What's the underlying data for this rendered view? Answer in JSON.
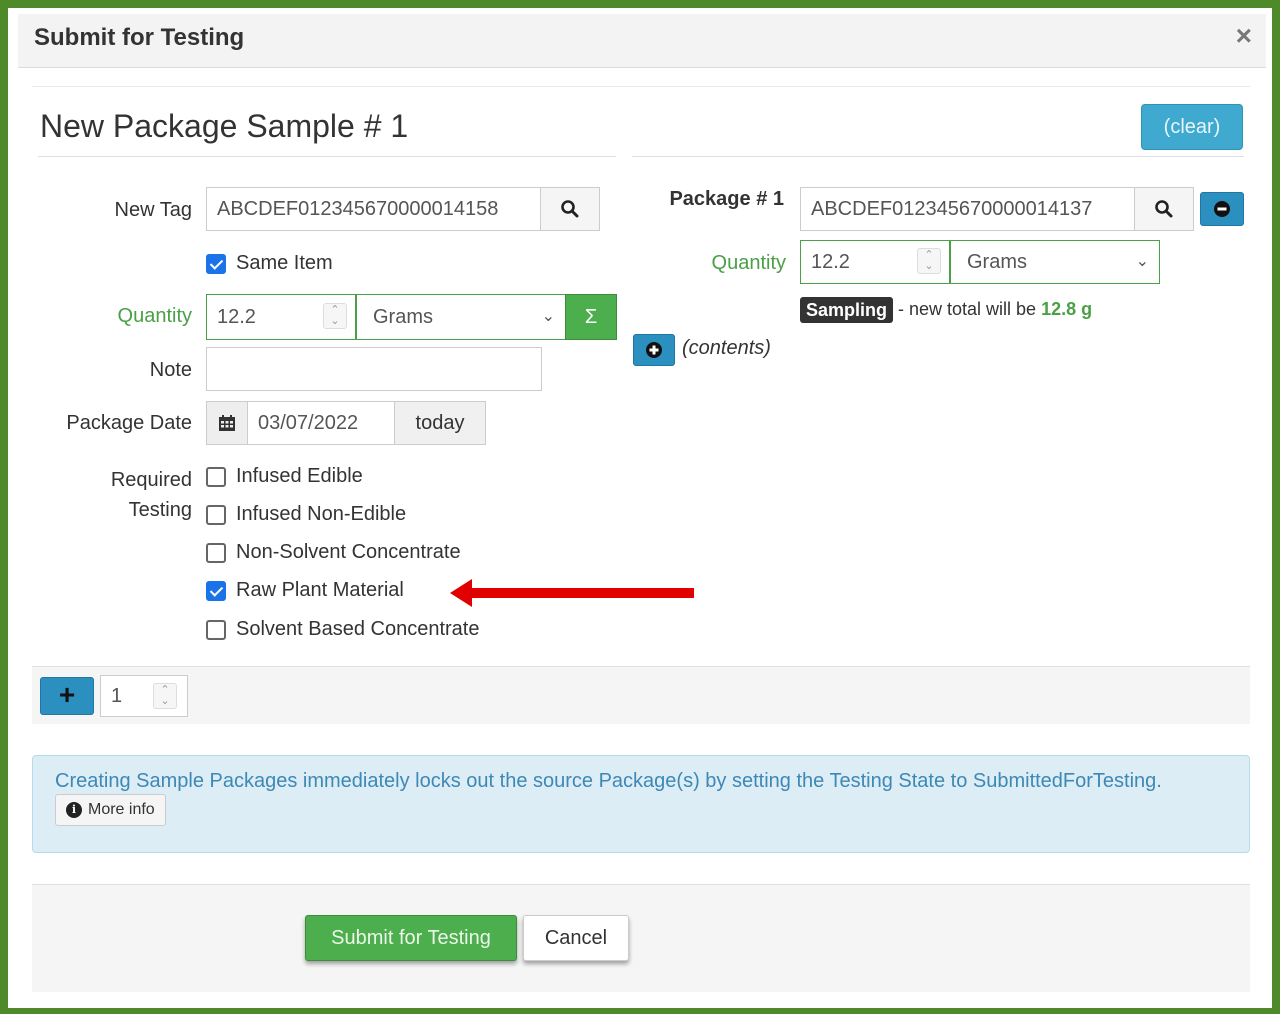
{
  "modal": {
    "title": "Submit for Testing",
    "close_symbol": "×"
  },
  "sample": {
    "title": "New Package Sample # 1",
    "clear_label": "(clear)",
    "new_tag_label": "New Tag",
    "new_tag_value": "ABCDEF012345670000014158",
    "same_item_label": "Same Item",
    "same_item_checked": true,
    "quantity_label": "Quantity",
    "quantity_value": "12.2",
    "unit_value": "Grams",
    "sigma_label": "Σ",
    "note_label": "Note",
    "note_value": "",
    "package_date_label": "Package Date",
    "package_date_value": "03/07/2022",
    "today_label": "today",
    "required_label_line1": "Required",
    "required_label_line2": "Testing",
    "testing_options": [
      {
        "label": "Infused Edible",
        "checked": false
      },
      {
        "label": "Infused Non-Edible",
        "checked": false
      },
      {
        "label": "Non-Solvent Concentrate",
        "checked": false
      },
      {
        "label": "Raw Plant Material",
        "checked": true
      },
      {
        "label": "Solvent Based Concentrate",
        "checked": false
      }
    ]
  },
  "source_package": {
    "label": "Package # 1",
    "tag_value": "ABCDEF012345670000014137",
    "quantity_label": "Quantity",
    "quantity_value": "12.2",
    "unit_value": "Grams",
    "sampling_badge": "Sampling",
    "sampling_text_prefix": "- new total will be",
    "sampling_total": "12.8 g",
    "contents_label": "(contents)"
  },
  "add_bar": {
    "add_label": "+",
    "count_value": "1"
  },
  "info": {
    "text": "Creating Sample Packages immediately locks out the source Package(s) by setting the Testing State to SubmittedForTesting.",
    "more_info_label": "More info",
    "info_icon_glyph": "i"
  },
  "footer": {
    "submit_label": "Submit for Testing",
    "cancel_label": "Cancel"
  },
  "colors": {
    "frame_green": "#4f8a2a",
    "accent_blue": "#2b8fc0",
    "success_green": "#4cae4c",
    "label_green": "#4aa046",
    "info_bg": "#dcedf6",
    "arrow_red": "#e00000"
  }
}
